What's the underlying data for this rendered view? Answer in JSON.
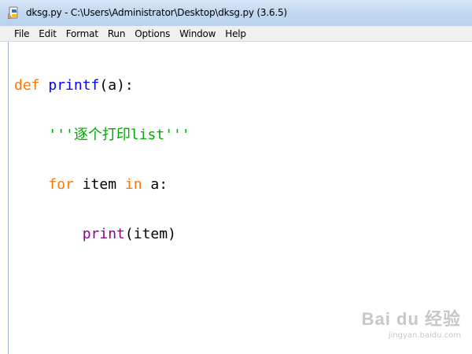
{
  "window": {
    "title": "dksg.py - C:\\Users\\Administrator\\Desktop\\dksg.py (3.6.5)"
  },
  "menu": {
    "items": [
      "File",
      "Edit",
      "Format",
      "Run",
      "Options",
      "Window",
      "Help"
    ]
  },
  "editor": {
    "lines": [
      [
        "def",
        " ",
        "printf",
        "(a):"
      ],
      [
        "    ",
        "'''逐个打印list'''"
      ],
      [
        "    ",
        "for",
        " item ",
        "in",
        " a:"
      ],
      [
        "        ",
        "print",
        "(item)"
      ]
    ]
  },
  "colors": {
    "keyword": "#ff7700",
    "definition": "#0000ff",
    "string": "#00aa00",
    "builtin": "#900090"
  },
  "watermark": {
    "logo": "Bai du 经验",
    "url": "jingyan.baidu.com"
  }
}
